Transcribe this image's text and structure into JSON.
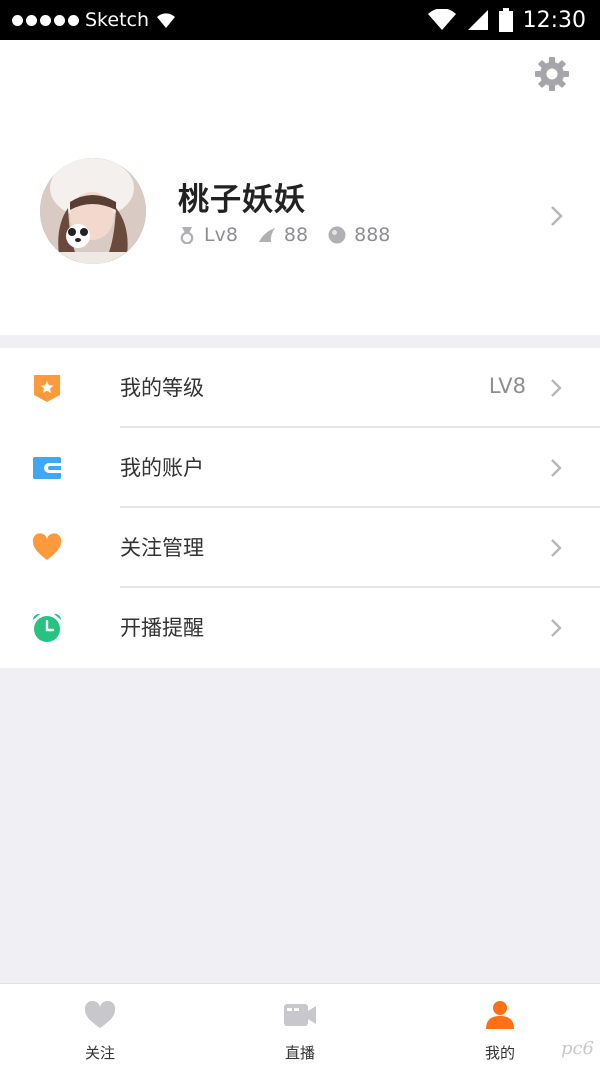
{
  "status_bar": {
    "carrier": "Sketch",
    "time": "12:30",
    "signal_icon": "signal-dots-icon",
    "wifi_icon": "wifi-icon",
    "cell_icon": "cell-signal-icon",
    "battery_icon": "battery-icon"
  },
  "header": {
    "settings_icon": "gear-icon"
  },
  "profile": {
    "name": "桃子妖妖",
    "level": "Lv8",
    "fans": "88",
    "coins": "888",
    "avatar_icon": "avatar"
  },
  "menu": {
    "items": [
      {
        "label": "我的等级",
        "value": "LV8",
        "icon": "level-badge-icon",
        "color": "#ff9a3c"
      },
      {
        "label": "我的账户",
        "value": "",
        "icon": "wallet-icon",
        "color": "#3da8f5"
      },
      {
        "label": "关注管理",
        "value": "",
        "icon": "heart-icon",
        "color": "#ff9a3c"
      },
      {
        "label": "开播提醒",
        "value": "",
        "icon": "alarm-clock-icon",
        "color": "#26c281"
      }
    ]
  },
  "tabbar": {
    "tabs": [
      {
        "label": "关注",
        "icon": "heart-icon",
        "active": false
      },
      {
        "label": "直播",
        "icon": "video-camera-icon",
        "active": false
      },
      {
        "label": "我的",
        "icon": "user-icon",
        "active": true
      }
    ],
    "active_color": "#ff6f16",
    "inactive_color": "#c7c7cc"
  },
  "watermark": "pc6"
}
